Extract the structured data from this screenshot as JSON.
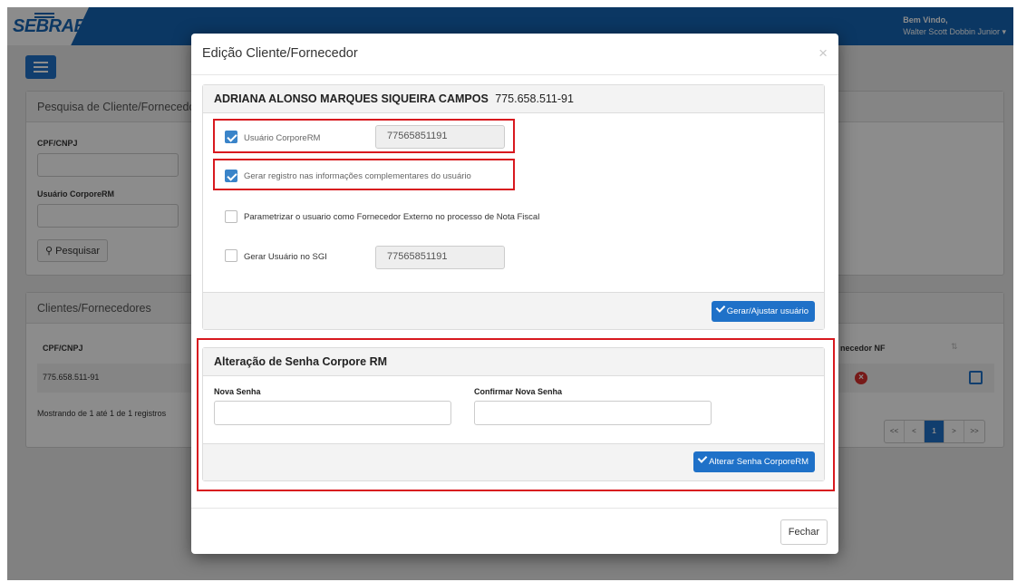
{
  "app": {
    "logo": "SEBRAE",
    "welcome_line1": "Bem Vindo,",
    "welcome_line2": "Walter Scott Dobbin Junior ▾",
    "search_panel": {
      "title": "Pesquisa de Cliente/Fornecedor",
      "cpf_label": "CPF/CNPJ",
      "user_label": "Usuário CorporeRM",
      "search_button": "Pesquisar"
    },
    "list_panel": {
      "title": "Clientes/Fornecedores",
      "columns": [
        "CPF/CNPJ",
        "necedor NF"
      ],
      "rows": [
        {
          "cpf": "775.658.511-91"
        }
      ],
      "info": "Mostrando de 1 até 1 de 1 registros",
      "pagination": [
        "<<",
        "<",
        "1",
        ">",
        ">>"
      ]
    }
  },
  "modal": {
    "title": "Edição Cliente/Fornecedor",
    "close": "×",
    "client": {
      "name": "ADRIANA ALONSO MARQUES SIQUEIRA CAMPOS",
      "cpf": "775.658.511-91"
    },
    "options": {
      "usuario_label": "Usuário CorporeRM",
      "usuario_value": "77565851191",
      "usuario_checked": true,
      "gerar_registro_label": "Gerar registro nas informações complementares do usuário",
      "gerar_registro_checked": true,
      "parametrizar_label": "Parametrizar o usuario como Fornecedor Externo no processo de Nota Fiscal",
      "parametrizar_checked": false,
      "sgi_label": "Gerar Usuário no SGI",
      "sgi_value": "77565851191",
      "sgi_checked": false
    },
    "gerar_button": "Gerar/Ajustar usuário",
    "senha": {
      "title": "Alteração de Senha Corpore RM",
      "nova_label": "Nova Senha",
      "confirmar_label": "Confirmar Nova Senha",
      "button": "Alterar Senha CorporeRM"
    },
    "fechar": "Fechar"
  },
  "colors": {
    "brand_blue": "#1565b5",
    "primary_button": "#1f71c8",
    "checkbox_checked": "#3a84c9",
    "highlight_box": "#d8191f"
  }
}
